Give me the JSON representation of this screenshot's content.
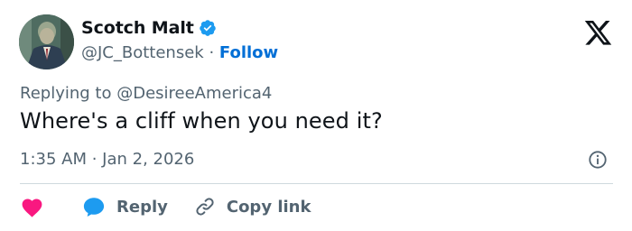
{
  "author": {
    "name": "Scotch Malt",
    "handle": "@JC_Bottensek",
    "separator": " · ",
    "follow_label": "Follow",
    "verified_color": "#1d9bf0",
    "avatar_icon": "profile-avatar"
  },
  "tweet": {
    "replying_prefix": "Replying to ",
    "replying_to": "@DesireeAmerica4",
    "text": "Where's a cliff when you need it?",
    "time": "1:35 AM · Jan 2, 2026"
  },
  "actions": {
    "like_icon": "heart-icon",
    "like_color": "#f91880",
    "reply_icon": "speech-bubble-icon",
    "reply_color": "#1d9bf0",
    "reply_label": "Reply",
    "copy_icon": "link-icon",
    "copy_label": "Copy link"
  },
  "brand": {
    "logo": "x-logo"
  }
}
